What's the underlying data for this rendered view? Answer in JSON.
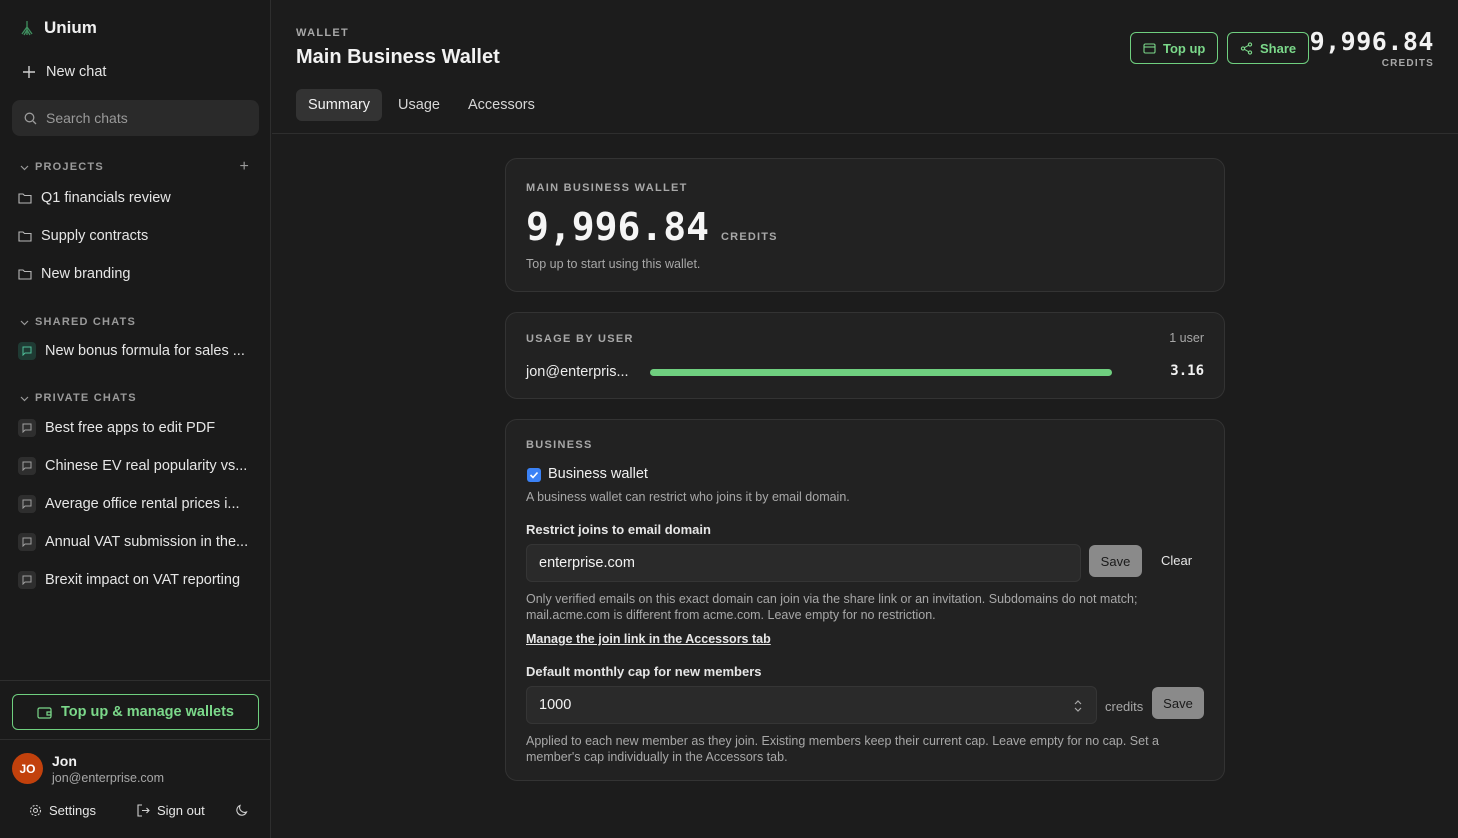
{
  "sidebar": {
    "brand": "Unium",
    "new_chat": "New chat",
    "search_placeholder": "Search chats",
    "projects_heading": "PROJECTS",
    "projects": [
      "Q1 financials review",
      "Supply contracts",
      "New branding"
    ],
    "shared_heading": "SHARED CHATS",
    "shared_chats": [
      "New bonus formula for sales ..."
    ],
    "private_heading": "PRIVATE CHATS",
    "private_chats": [
      "Best free apps to edit PDF",
      "Chinese EV real popularity vs...",
      "Average office rental prices i...",
      "Annual VAT submission in the...",
      "Brexit impact on VAT reporting"
    ],
    "topup_manage": "Top up & manage wallets",
    "user": {
      "initials": "JO",
      "name": "Jon",
      "email": "jon@enterprise.com"
    },
    "settings": "Settings",
    "sign_out": "Sign out"
  },
  "header": {
    "eyebrow": "WALLET",
    "title": "Main Business Wallet",
    "tabs": [
      "Summary",
      "Usage",
      "Accessors"
    ],
    "active_tab": "Summary",
    "topup": "Top up",
    "share": "Share",
    "credits_value": "9,996.84",
    "credits_unit": "CREDITS"
  },
  "balance_card": {
    "label": "MAIN BUSINESS WALLET",
    "value": "9,996.84",
    "unit": "CREDITS",
    "note": "Top up to start using this wallet."
  },
  "usage_card": {
    "label": "USAGE BY USER",
    "count": "1 user",
    "rows": [
      {
        "user": "jon@enterpris...",
        "value": "3.16",
        "fill_fraction": 1.0
      }
    ]
  },
  "business_card": {
    "label": "BUSINESS",
    "checkbox_label": "Business wallet",
    "checkbox_checked": true,
    "checkbox_help": "A business wallet can restrict who joins it by email domain.",
    "domain_label": "Restrict joins to email domain",
    "domain_value": "enterprise.com",
    "save": "Save",
    "clear": "Clear",
    "domain_help": "Only verified emails on this exact domain can join via the share link or an invitation. Subdomains do not match; mail.acme.com is different from acme.com. Leave empty for no restriction.",
    "manage_link": "Manage the join link in the Accessors tab",
    "cap_label": "Default monthly cap for new members",
    "cap_value": "1000",
    "cap_unit": "credits",
    "cap_help": "Applied to each new member as they join. Existing members keep their current cap. Leave empty for no cap. Set a member's cap individually in the Accessors tab."
  },
  "colors": {
    "accent": "#6fcf7f",
    "avatar": "#c2410c",
    "checkbox": "#3b82f6"
  },
  "icons": [
    "unium-logo-icon",
    "plus-icon",
    "search-icon",
    "chevron-down-icon",
    "folder-icon",
    "chat-bubble-icon",
    "wallet-icon",
    "share-icon",
    "gear-icon",
    "sign-out-icon",
    "moon-icon",
    "stepper-icon",
    "check-icon"
  ]
}
